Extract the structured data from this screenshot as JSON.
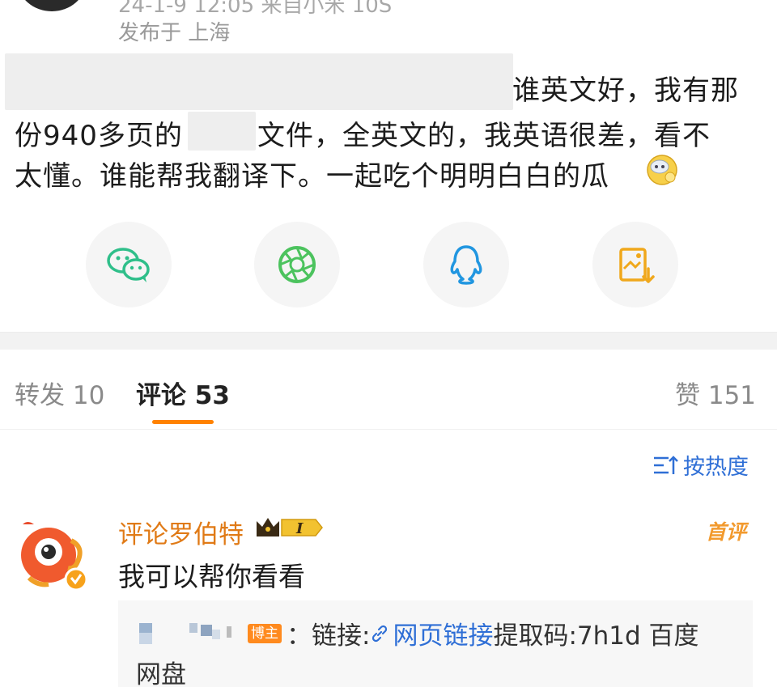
{
  "post": {
    "meta_line": "24-1-9 12:05  来自小米 10S",
    "location": "发布于 上海",
    "line1_end": "谁英文好，我有那",
    "line2_start": "份940多页的",
    "line2_end": "文件，全英文的，我英语很差，看不",
    "line3": "太懂。谁能帮我翻译下。一起吃个明明白白的瓜"
  },
  "share": {
    "icons": [
      "wechat-icon",
      "moments-icon",
      "qq-icon",
      "save-image-icon"
    ],
    "colors": {
      "wechat": "#2fbf8a",
      "moments": "#4cc35e",
      "qq": "#2196e0",
      "save": "#f0a81c"
    }
  },
  "tabs": {
    "repost": "转发 10",
    "comments": "评论 53",
    "likes": "赞 151"
  },
  "sort": {
    "label": "按热度"
  },
  "comment": {
    "username": "评论罗伯特",
    "level": "I",
    "first_badge": "首评",
    "text": "我可以帮你看看",
    "reply": {
      "owner_badge": "博主",
      "colon_link": "：链接:",
      "link_label": "网页链接",
      "code_text": " 提取码:7h1d 百度",
      "line2": "网盘"
    }
  },
  "colors": {
    "accent": "#ff8200",
    "link": "#2f6fd6",
    "username": "#e07a16"
  }
}
